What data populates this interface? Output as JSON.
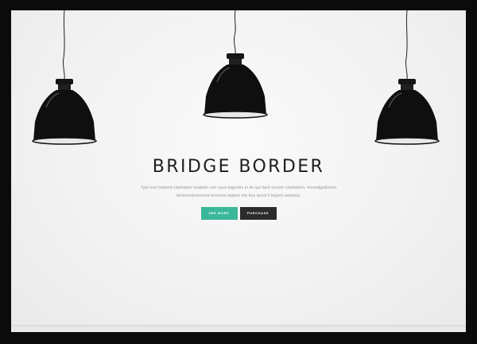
{
  "hero": {
    "title": "BRIDGE BORDER",
    "subtitle_line1": "Typi non habent claritatem insitam; est usus legentis in iis qui facit eorum claritatem. Investigationes",
    "subtitle_line2": "demonstraverunt lectores legere me lius quod ii legunt saepius.",
    "buttons": {
      "see_more": "SEE MORE",
      "purchase": "PURCHASE"
    }
  },
  "colors": {
    "frame": "#0b0b0b",
    "primary_button": "#3ab79a",
    "secondary_button": "#2b2b2b",
    "title_text": "#1e1e1e"
  },
  "decor": {
    "lamps": [
      "pendant-lamp-icon",
      "pendant-lamp-icon",
      "pendant-lamp-icon"
    ]
  }
}
